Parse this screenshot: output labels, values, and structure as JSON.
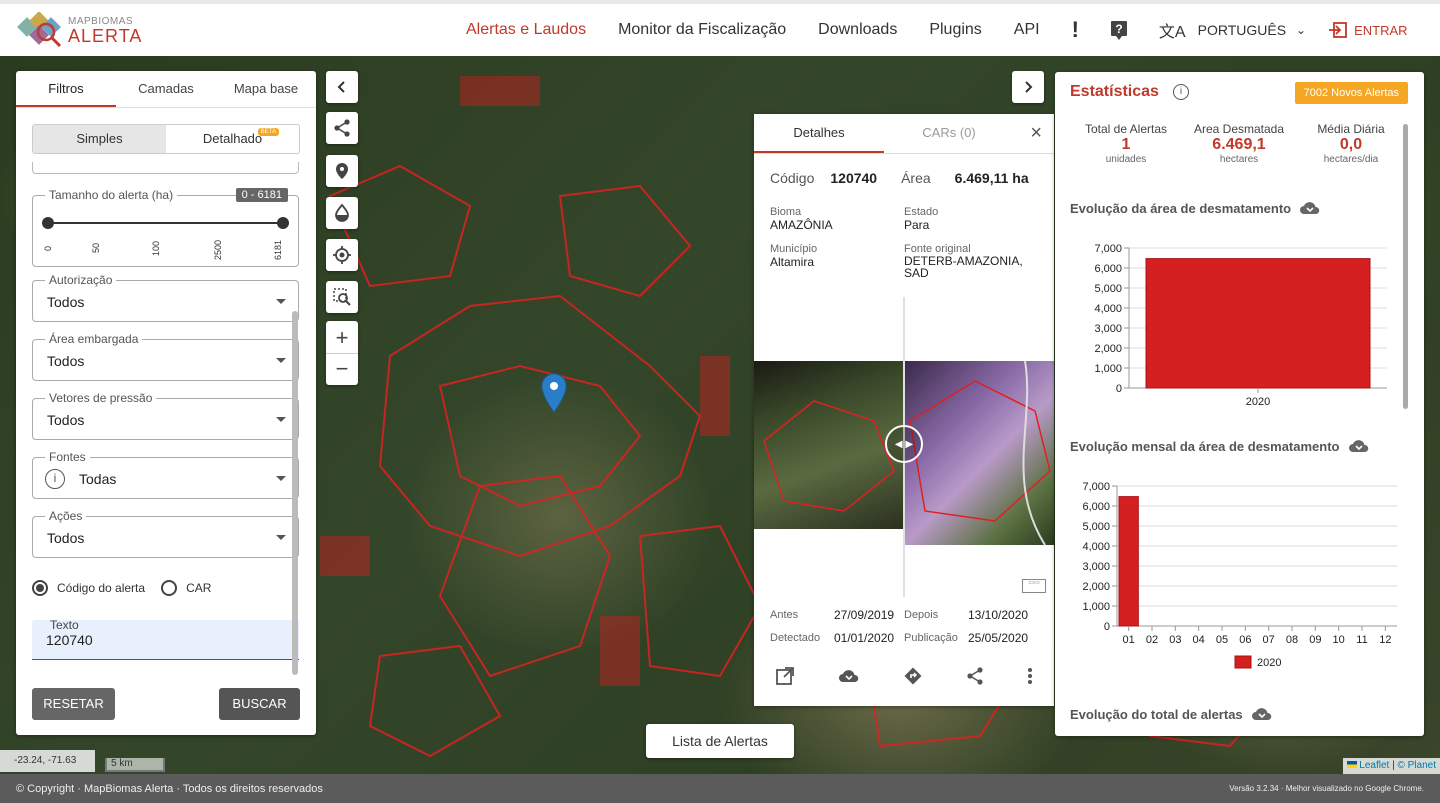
{
  "header": {
    "logo_small": "MAPBIOMAS",
    "logo_big": "ALERTA",
    "nav": [
      "Alertas e Laudos",
      "Monitor da Fiscalização",
      "Downloads",
      "Plugins",
      "API"
    ],
    "language": "PORTUGUÊS",
    "login": "ENTRAR"
  },
  "left_panel": {
    "tabs": [
      "Filtros",
      "Camadas",
      "Mapa base"
    ],
    "mode": [
      "Simples",
      "Detalhado"
    ],
    "beta": "BETA",
    "size_label": "Tamanho do alerta (ha)",
    "size_range": "0 - 6181",
    "size_ticks": [
      "0",
      "50",
      "100",
      "2500",
      "6181"
    ],
    "autorizacao_label": "Autorização",
    "autorizacao_value": "Todos",
    "embargada_label": "Área embargada",
    "embargada_value": "Todos",
    "vetores_label": "Vetores de pressão",
    "vetores_value": "Todos",
    "fontes_label": "Fontes",
    "fontes_value": "Todas",
    "acoes_label": "Ações",
    "acoes_value": "Todos",
    "radio_codigo": "Código do alerta",
    "radio_car": "CAR",
    "texto_label": "Texto",
    "texto_value": "120740",
    "reset": "RESETAR",
    "search": "BUSCAR"
  },
  "detail": {
    "tabs": [
      "Detalhes",
      "CARs (0)"
    ],
    "codigo_label": "Código",
    "codigo": "120740",
    "area_label": "Área",
    "area": "6.469,11 ha",
    "bioma_label": "Bioma",
    "bioma": "AMAZÔNIA",
    "estado_label": "Estado",
    "estado": "Para",
    "municipio_label": "Município",
    "municipio": "Altamira",
    "fonte_label": "Fonte original",
    "fonte": "DETERB-AMAZONIA, SAD",
    "antes_label": "Antes",
    "antes": "27/09/2019",
    "depois_label": "Depois",
    "depois": "13/10/2020",
    "detectado_label": "Detectado",
    "detectado": "01/01/2020",
    "publicacao_label": "Publicação",
    "publicacao": "25/05/2020"
  },
  "stats": {
    "title": "Estatísticas",
    "badge": "7002 Novos Alertas",
    "total_label": "Total de Alertas",
    "total_value": "1",
    "total_unit": "unidades",
    "area_label": "Area Desmatada",
    "area_value": "6.469,1",
    "area_unit": "hectares",
    "media_label": "Média Diária",
    "media_value": "0,0",
    "media_unit": "hectares/dia",
    "chart1_title": "Evolução da área de desmatamento",
    "chart2_title": "Evolução mensal da área de desmatamento",
    "chart3_title": "Evolução do total de alertas",
    "accent": "#c0392b",
    "badge_color": "#f5a623"
  },
  "chart_data": [
    {
      "type": "bar",
      "title": "Evolução da área de desmatamento",
      "categories": [
        "2020"
      ],
      "values": [
        6469.1
      ],
      "yticks": [
        "0",
        "1,000",
        "2,000",
        "3,000",
        "4,000",
        "5,000",
        "6,000",
        "7,000"
      ],
      "ylim": [
        0,
        7000
      ]
    },
    {
      "type": "bar",
      "title": "Evolução mensal da área de desmatamento",
      "categories": [
        "01",
        "02",
        "03",
        "04",
        "05",
        "06",
        "07",
        "08",
        "09",
        "10",
        "11",
        "12"
      ],
      "series": [
        {
          "name": "2020",
          "values": [
            6469.1,
            0,
            0,
            0,
            0,
            0,
            0,
            0,
            0,
            0,
            0,
            0
          ]
        }
      ],
      "yticks": [
        "0",
        "1,000",
        "2,000",
        "3,000",
        "4,000",
        "5,000",
        "6,000",
        "7,000"
      ],
      "ylim": [
        0,
        7000
      ]
    }
  ],
  "map": {
    "list_button": "Lista de Alertas",
    "coords": "-23.24, -71.63",
    "scale": "5 km",
    "attribution_leaflet": "Leaflet",
    "attribution_planet": "© Planet"
  },
  "footer": {
    "copyright": "© Copyright · MapBiomas Alerta · Todos os direitos reservados",
    "version": "Versão 3.2.34 · Melhor visualizado no Google Chrome."
  }
}
